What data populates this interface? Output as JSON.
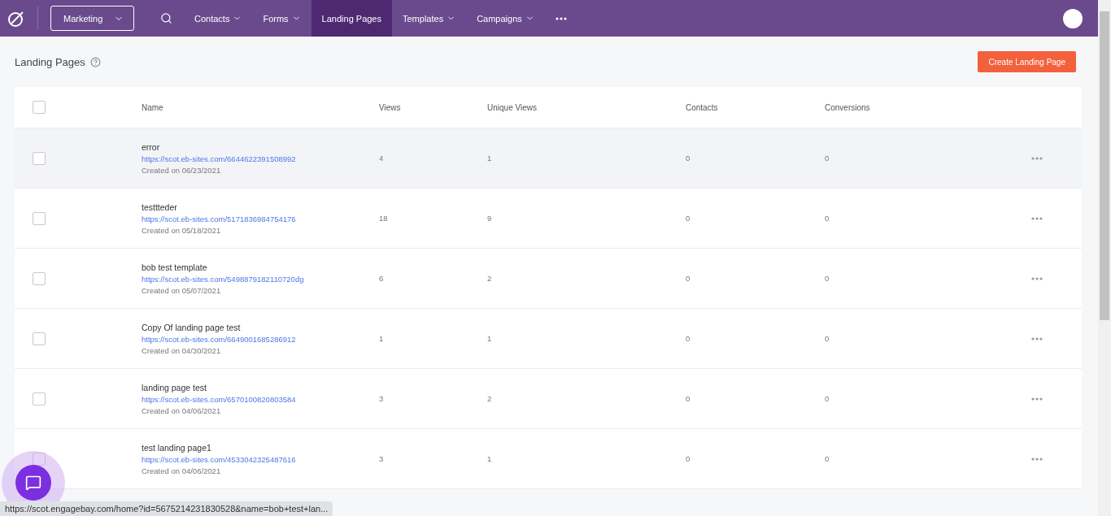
{
  "nav": {
    "workspace": "Marketing",
    "items": [
      {
        "label": "Contacts",
        "dropdown": true,
        "selected": false
      },
      {
        "label": "Forms",
        "dropdown": true,
        "selected": false
      },
      {
        "label": "Landing Pages",
        "dropdown": false,
        "selected": true
      },
      {
        "label": "Templates",
        "dropdown": true,
        "selected": false
      },
      {
        "label": "Campaigns",
        "dropdown": true,
        "selected": false
      }
    ]
  },
  "page": {
    "title": "Landing Pages",
    "create_button": "Create Landing Page"
  },
  "table": {
    "columns": [
      "Name",
      "Views",
      "Unique Views",
      "Contacts",
      "Conversions"
    ],
    "all_checked": false,
    "rows": [
      {
        "name": "error",
        "url": "https://scot.eb-sites.com/6644622391508992",
        "created": "Created on 06/23/2021",
        "views": "4",
        "unique_views": "1",
        "contacts": "0",
        "conversions": "0",
        "checked": false,
        "highlighted": true
      },
      {
        "name": "testtteder",
        "url": "https://scot.eb-sites.com/5171836984754176",
        "created": "Created on 05/18/2021",
        "views": "18",
        "unique_views": "9",
        "contacts": "0",
        "conversions": "0",
        "checked": false,
        "highlighted": false
      },
      {
        "name": "bob test template",
        "url": "https://scot.eb-sites.com/5498879182110720dg",
        "created": "Created on 05/07/2021",
        "views": "6",
        "unique_views": "2",
        "contacts": "0",
        "conversions": "0",
        "checked": false,
        "highlighted": false
      },
      {
        "name": "Copy Of landing page test",
        "url": "https://scot.eb-sites.com/6649001685286912",
        "created": "Created on 04/30/2021",
        "views": "1",
        "unique_views": "1",
        "contacts": "0",
        "conversions": "0",
        "checked": false,
        "highlighted": false
      },
      {
        "name": "landing page test",
        "url": "https://scot.eb-sites.com/6570100820803584",
        "created": "Created on 04/06/2021",
        "views": "3",
        "unique_views": "2",
        "contacts": "0",
        "conversions": "0",
        "checked": false,
        "highlighted": false
      },
      {
        "name": "test landing page1",
        "url": "https://scot.eb-sites.com/4533042325487616",
        "created": "Created on 04/06/2021",
        "views": "3",
        "unique_views": "1",
        "contacts": "0",
        "conversions": "0",
        "checked": false,
        "highlighted": false
      }
    ]
  },
  "status_bar": "https://scot.engagebay.com/home?id=5675214231830528&name=bob+test+lan..."
}
